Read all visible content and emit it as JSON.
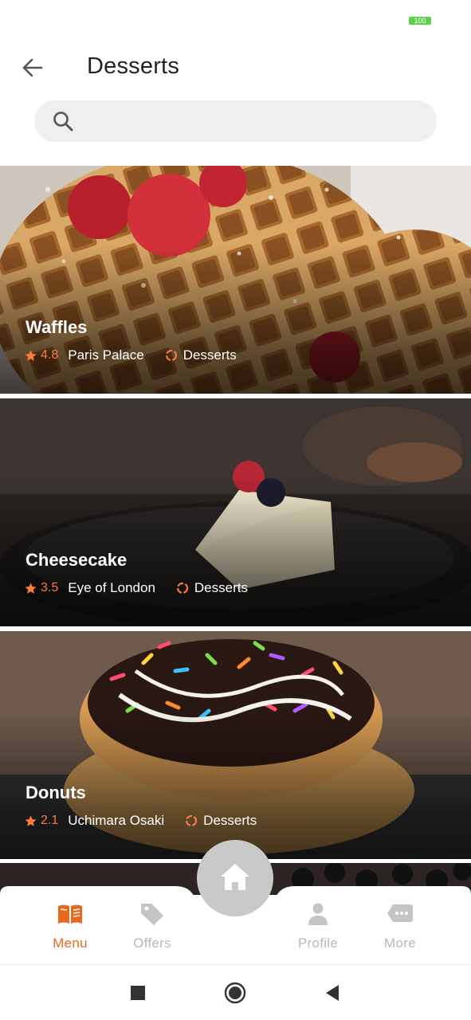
{
  "status": {
    "battery": "100"
  },
  "header": {
    "title": "Desserts"
  },
  "search": {
    "placeholder": "",
    "value": ""
  },
  "cards": [
    {
      "title": "Waffles",
      "rating": "4.8",
      "venue": "Paris Palace",
      "category": "Desserts"
    },
    {
      "title": "Cheesecake",
      "rating": "3.5",
      "venue": "Eye of London",
      "category": "Desserts"
    },
    {
      "title": "Donuts",
      "rating": "2.1",
      "venue": "Uchimara Osaki",
      "category": "Desserts"
    }
  ],
  "nav": {
    "menu": "Menu",
    "offers": "Offers",
    "profile": "Profile",
    "more": "More"
  },
  "icons": {
    "back": "arrow-left-icon",
    "search": "search-icon",
    "star": "star-icon",
    "category": "circle-dashed-icon",
    "menu": "book-icon",
    "offers": "tag-icon",
    "home": "home-icon",
    "profile": "person-icon",
    "more": "chat-dots-icon"
  },
  "colors": {
    "accent": "#e86a1e",
    "rating": "#ff7a3d",
    "inactive": "#b9b9b9"
  }
}
